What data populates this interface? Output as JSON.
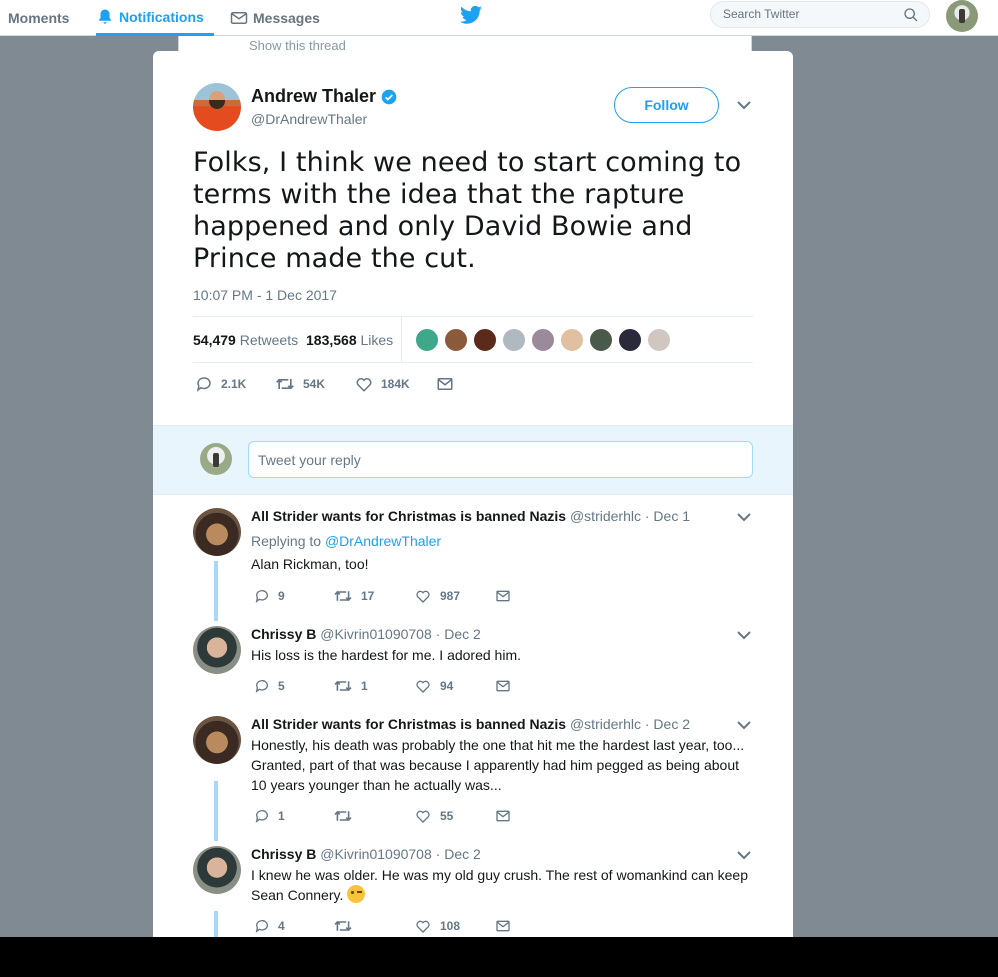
{
  "nav": {
    "moments": "Moments",
    "notifications": "Notifications",
    "messages": "Messages",
    "search_placeholder": "Search Twitter"
  },
  "behind": {
    "show_thread": "Show this thread"
  },
  "tweet": {
    "name": "Andrew Thaler",
    "handle": "@DrAndrewThaler",
    "follow": "Follow",
    "text": "Folks, I think we need to start coming to terms with the idea that the rapture happened and only David Bowie and Prince made the cut.",
    "time": "10:07 PM - 1 Dec 2017",
    "retweets_count": "54,479",
    "retweets_label": "Retweets",
    "likes_count": "183,568",
    "likes_label": "Likes",
    "reply_count": "2.1K",
    "retweet_count": "54K",
    "like_count": "184K",
    "liker_colors": [
      "#3fa88a",
      "#8a5a3a",
      "#5a2a1a",
      "#b0b8c0",
      "#9a8a9a",
      "#e0c0a0",
      "#4a5a4a",
      "#2a2a3a",
      "#d0c8c0"
    ]
  },
  "reply_box": {
    "placeholder": "Tweet your reply"
  },
  "replies": [
    {
      "name": "All Strider wants for Christmas is banned Nazis",
      "handle": "@striderhlc",
      "date": "· Dec 1",
      "replying_prefix": "Replying to",
      "replying_to": "@DrAndrewThaler",
      "text": "Alan Rickman, too!",
      "replies": "9",
      "retweets": "17",
      "likes": "987"
    },
    {
      "name": "Chrissy B",
      "handle": "@Kivrin01090708",
      "date": "· Dec 2",
      "text": "His loss is the hardest for me. I adored him.",
      "replies": "5",
      "retweets": "1",
      "likes": "94"
    },
    {
      "name": "All Strider wants for Christmas is banned Nazis",
      "handle": "@striderhlc",
      "date": "· Dec 2",
      "text_lines": [
        "Honestly, his death was probably the one that hit me the hardest last year, too...",
        "Granted, part of that was because I apparently had him pegged as being about",
        "10 years younger than he actually was..."
      ],
      "replies": "1",
      "retweets": "",
      "likes": "55"
    },
    {
      "name": "Chrissy B",
      "handle": "@Kivrin01090708",
      "date": "· Dec 2",
      "text_lines": [
        "I knew he was older. He was my old guy crush. The rest of womankind can keep",
        "Sean Connery."
      ],
      "replies": "4",
      "retweets": "",
      "likes": "108"
    }
  ]
}
